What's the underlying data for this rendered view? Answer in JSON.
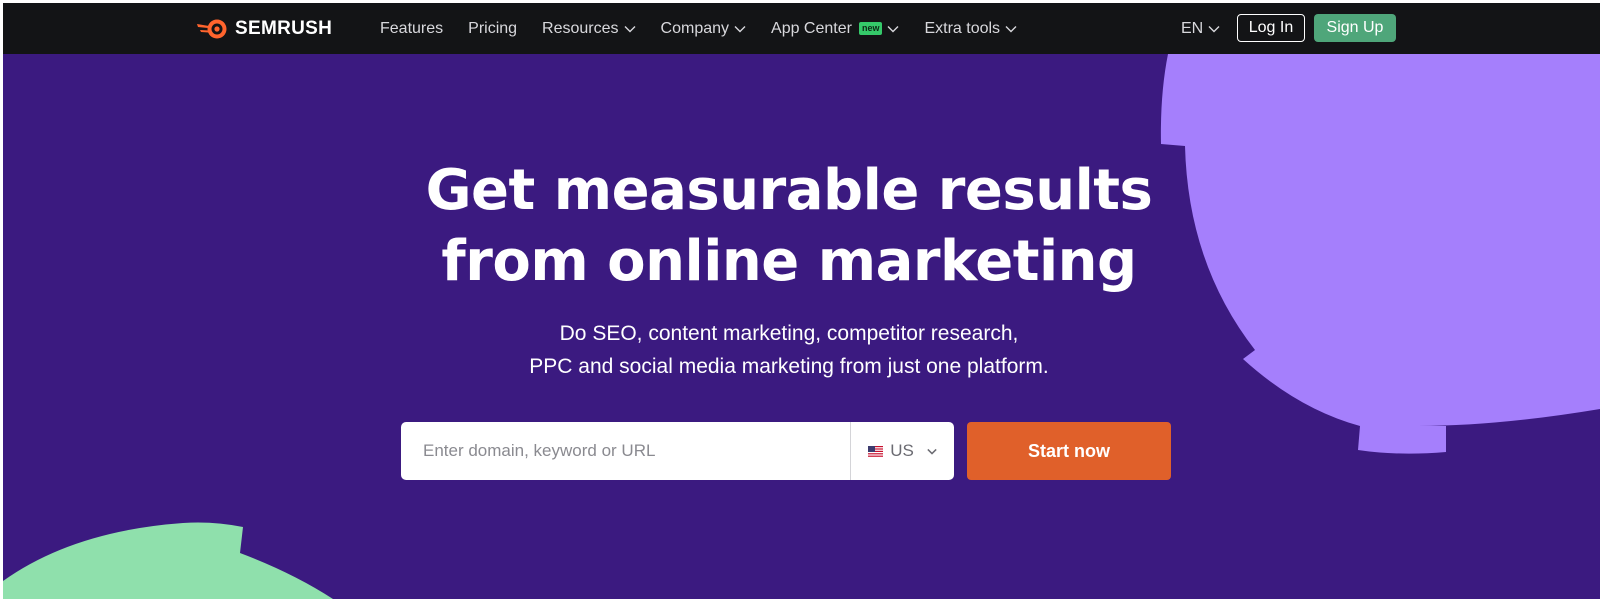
{
  "brand": {
    "name": "SEMRUSH",
    "logo_color": "#ff642d"
  },
  "nav": {
    "items": [
      {
        "label": "Features",
        "dropdown": false
      },
      {
        "label": "Pricing",
        "dropdown": false
      },
      {
        "label": "Resources",
        "dropdown": true
      },
      {
        "label": "Company",
        "dropdown": true
      },
      {
        "label": "App Center",
        "dropdown": true,
        "badge": "new"
      },
      {
        "label": "Extra tools",
        "dropdown": true
      }
    ],
    "language": "EN",
    "login_label": "Log In",
    "signup_label": "Sign Up"
  },
  "hero": {
    "headline_line1": "Get measurable results",
    "headline_line2": "from online marketing",
    "subtext_line1": "Do SEO, content marketing, competitor research,",
    "subtext_line2": "PPC and social media marketing from just one platform.",
    "search_placeholder": "Enter domain, keyword or URL",
    "country_code": "US",
    "start_label": "Start now"
  },
  "colors": {
    "navbar_bg": "#131416",
    "hero_bg": "#3b1a80",
    "purple_shape": "#a57ffc",
    "green_shape": "#8fe0ac",
    "start_button": "#e0602a",
    "signup_button": "#4fa67a"
  }
}
